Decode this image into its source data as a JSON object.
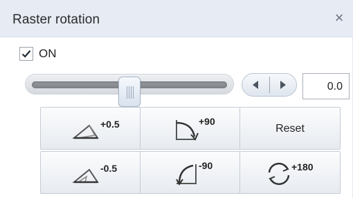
{
  "panel": {
    "title": "Raster rotation",
    "close_glyph": "×"
  },
  "enable": {
    "checked": true,
    "label": "ON"
  },
  "slider": {
    "fraction": 0.5
  },
  "stepper": {
    "left_icon": "triangle-left-icon",
    "right_icon": "triangle-right-icon"
  },
  "value": "0.0",
  "buttons": {
    "rotate_plus_small": {
      "label": "+0.5",
      "icon": "small-angle-rotate-icon"
    },
    "rotate_plus_90": {
      "label": "+90",
      "icon": "quarter-turn-cw-icon"
    },
    "reset": {
      "label": "Reset"
    },
    "rotate_minus_small": {
      "label": "-0.5",
      "icon": "small-angle-rotate-icon"
    },
    "rotate_minus_90": {
      "label": "-90",
      "icon": "quarter-turn-ccw-icon"
    },
    "rotate_180": {
      "label": "+180",
      "icon": "circular-arrows-icon"
    }
  }
}
